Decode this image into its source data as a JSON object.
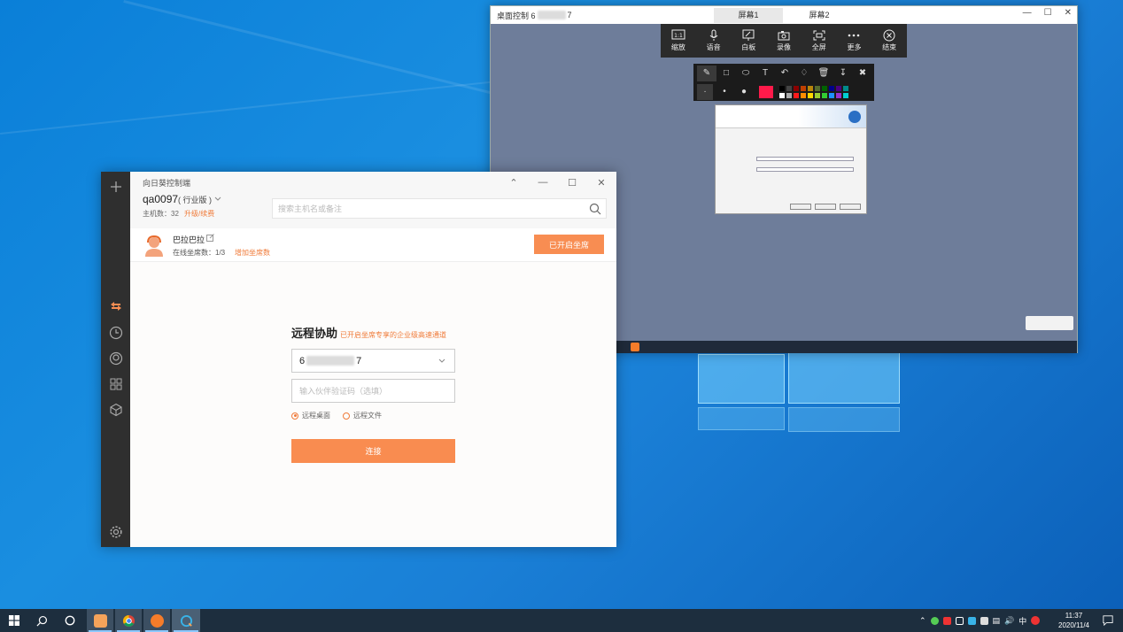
{
  "remote_window": {
    "title_prefix": "桌面控制 6",
    "title_suffix": "7",
    "tabs": [
      {
        "label": "屏幕1"
      },
      {
        "label": "屏幕2"
      }
    ],
    "toolbar": [
      {
        "label": "缩放",
        "icon": "zoom-1to1-icon"
      },
      {
        "label": "语音",
        "icon": "microphone-icon"
      },
      {
        "label": "白板",
        "icon": "whiteboard-icon"
      },
      {
        "label": "录像",
        "icon": "camera-icon"
      },
      {
        "label": "全屏",
        "icon": "fullscreen-icon"
      },
      {
        "label": "更多",
        "icon": "more-icon"
      },
      {
        "label": "结束",
        "icon": "close-circle-icon"
      }
    ],
    "draw_tools": [
      "pen-icon",
      "rectangle-icon",
      "ellipse-icon",
      "text-icon",
      "undo-icon",
      "eraser-icon",
      "trash-icon",
      "download-icon",
      "close-icon"
    ],
    "selected_color": "#ff1a4a",
    "palette": [
      "#000000",
      "#444444",
      "#8b0000",
      "#c04000",
      "#b8860b",
      "#556b2f",
      "#006400",
      "#00008b",
      "#4b0082",
      "#008b8b",
      "#ffffff",
      "#aaaaaa",
      "#ff1a1a",
      "#ff8c00",
      "#ffd700",
      "#9acd32",
      "#32cd32",
      "#1e90ff",
      "#9932cc",
      "#00ced1"
    ]
  },
  "app": {
    "title": "向日葵控制端",
    "account": "qa0097",
    "edition": "( 行业版 )",
    "host_count": "主机数：32",
    "upgrade_link": "升级/续费",
    "search_placeholder": "搜索主机名或备注",
    "seat": {
      "name": "巴拉巴拉",
      "online": "在线坐席数：1/3",
      "add_link": "增加坐席数",
      "button": "已开启坐席"
    },
    "assist": {
      "title": "远程协助",
      "subtitle": "已开启坐席专享的企业级高速通道",
      "device_prefix": "6",
      "device_suffix": "7",
      "code_placeholder": "输入伙伴验证码（选填）",
      "radio_desktop": "远程桌面",
      "radio_file": "远程文件",
      "connect": "连接"
    },
    "accent": "#f88d52"
  },
  "taskbar": {
    "lang": "中",
    "time": "11:37",
    "date": "2020/11/4"
  }
}
